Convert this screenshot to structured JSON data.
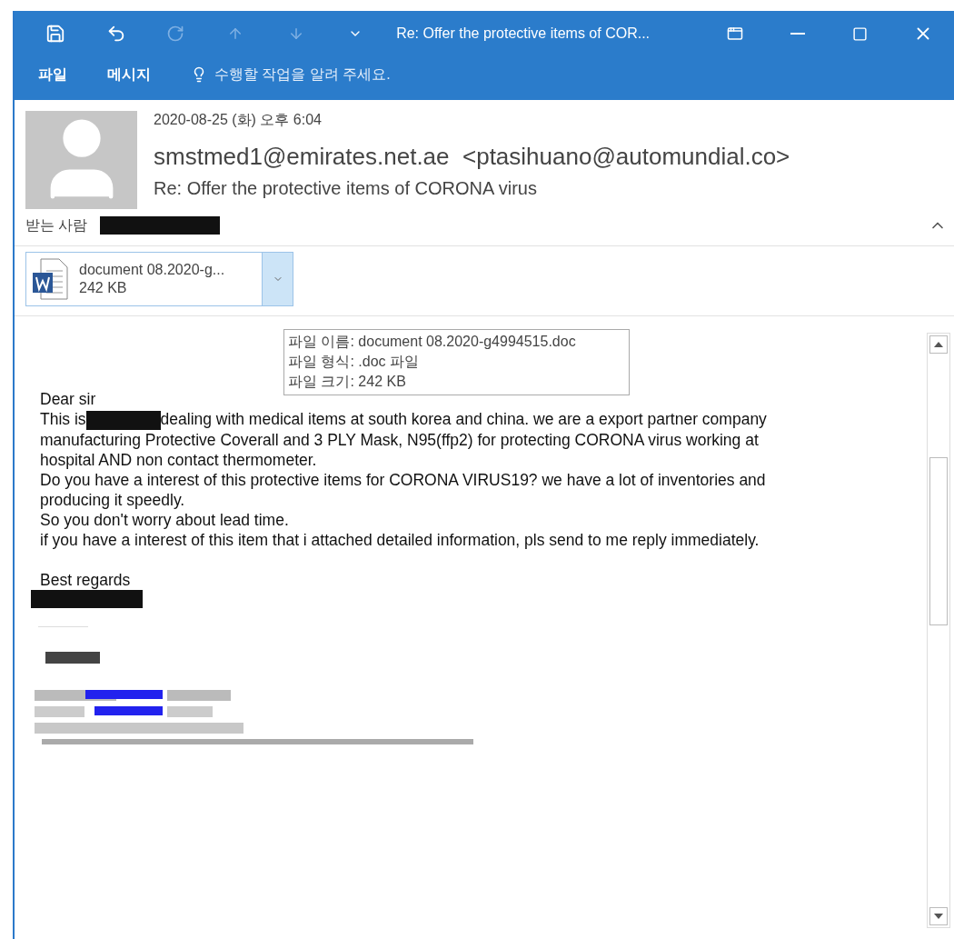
{
  "title_bar": {
    "title": "Re: Offer the protective items of COR...",
    "quick_access": [
      {
        "kind": "save",
        "disabled": false
      },
      {
        "kind": "undo",
        "disabled": false
      },
      {
        "kind": "redo",
        "disabled": true
      },
      {
        "kind": "up",
        "disabled": true
      },
      {
        "kind": "down",
        "disabled": true
      },
      {
        "kind": "customize",
        "disabled": false
      }
    ]
  },
  "ribbon_tabs": [
    {
      "label": "파일"
    },
    {
      "label": "메시지"
    }
  ],
  "tell_me": {
    "placeholder": "수행할 작업을 알려 주세요."
  },
  "header": {
    "date": "2020-08-25 (화) 오후 6:04",
    "sender": "smstmed1@emirates.net.ae",
    "sender_address": "<ptasihuano@automundial.co>",
    "subject": "Re: Offer the protective items of CORONA virus",
    "to_label": "받는 사람",
    "to_redacted": true
  },
  "attachment": {
    "name": "document 08.2020-g...",
    "size": "242 KB"
  },
  "tooltip": [
    {
      "label": "파일 이름:",
      "value": "document 08.2020-g4994515.doc"
    },
    {
      "label": "파일 형식:",
      "value": ".doc 파일"
    },
    {
      "label": "파일 크기:",
      "value": "242 KB"
    }
  ],
  "body": {
    "lines": [
      {
        "text": "Dear sir"
      },
      {
        "text": "This is",
        "redacted": true,
        "after": "dealing with medical items at south korea and china. we are a export partner company"
      },
      {
        "text": "manufacturing Protective Coverall and 3 PLY Mask, N95(ffp2) for protecting CORONA virus working at"
      },
      {
        "text": "hospital AND  non contact thermometer."
      },
      {
        "text": "Do you have a interest of this protective items for CORONA VIRUS19? we have a lot of inventories and"
      },
      {
        "text": "producing it speedly."
      },
      {
        "text": "So you don't worry about lead time."
      },
      {
        "text": "if you have a interest of this item that i attached detailed information, pls send to me reply immediately."
      }
    ],
    "closing": "Best regards",
    "signature_redacted": true
  }
}
